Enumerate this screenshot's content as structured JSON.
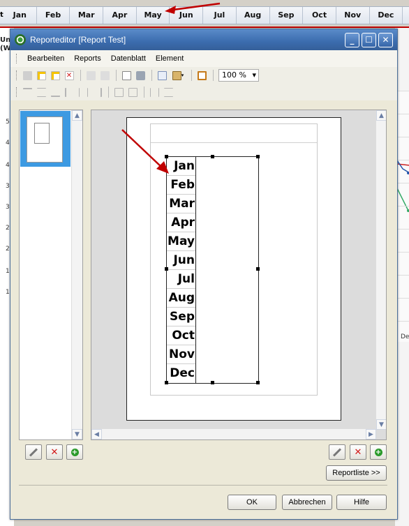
{
  "background": {
    "months": [
      "Jan",
      "Feb",
      "Mar",
      "Apr",
      "May",
      "Jun",
      "Jul",
      "Aug",
      "Sep",
      "Oct",
      "Nov",
      "Dec"
    ],
    "left_fragment_1": "t",
    "left_fragment_2": "Un",
    "left_fragment_3": "(W",
    "axis_fragment": "De",
    "y_fragments": [
      "5",
      "4",
      "4",
      "3",
      "3",
      "2",
      "2",
      "1",
      "1"
    ]
  },
  "window": {
    "title": "Reporteditor [Report Test]",
    "minimize": "_",
    "maximize": "☐",
    "close": "✕"
  },
  "menu": [
    "Bearbeiten",
    "Reports",
    "Datenblatt",
    "Element"
  ],
  "toolbar": {
    "zoom_value": "100 %",
    "zoom_arrow": "▾"
  },
  "report": {
    "months": [
      "Jan",
      "Feb",
      "Mar",
      "Apr",
      "May",
      "Jun",
      "Jul",
      "Aug",
      "Sep",
      "Oct",
      "Nov",
      "Dec"
    ]
  },
  "scroll": {
    "up": "▲",
    "down": "▼",
    "left": "◀",
    "right": "▶"
  },
  "buttons": {
    "reportliste": "Reportliste >>",
    "ok": "OK",
    "abbrechen": "Abbrechen",
    "hilfe": "Hilfe"
  },
  "colors": {
    "title_bar": "#3b6cae",
    "selection": "#3d9ae2",
    "annotation_arrow": "#c00000",
    "red_x": "#d21818",
    "green_plus": "#2a9a2a"
  }
}
